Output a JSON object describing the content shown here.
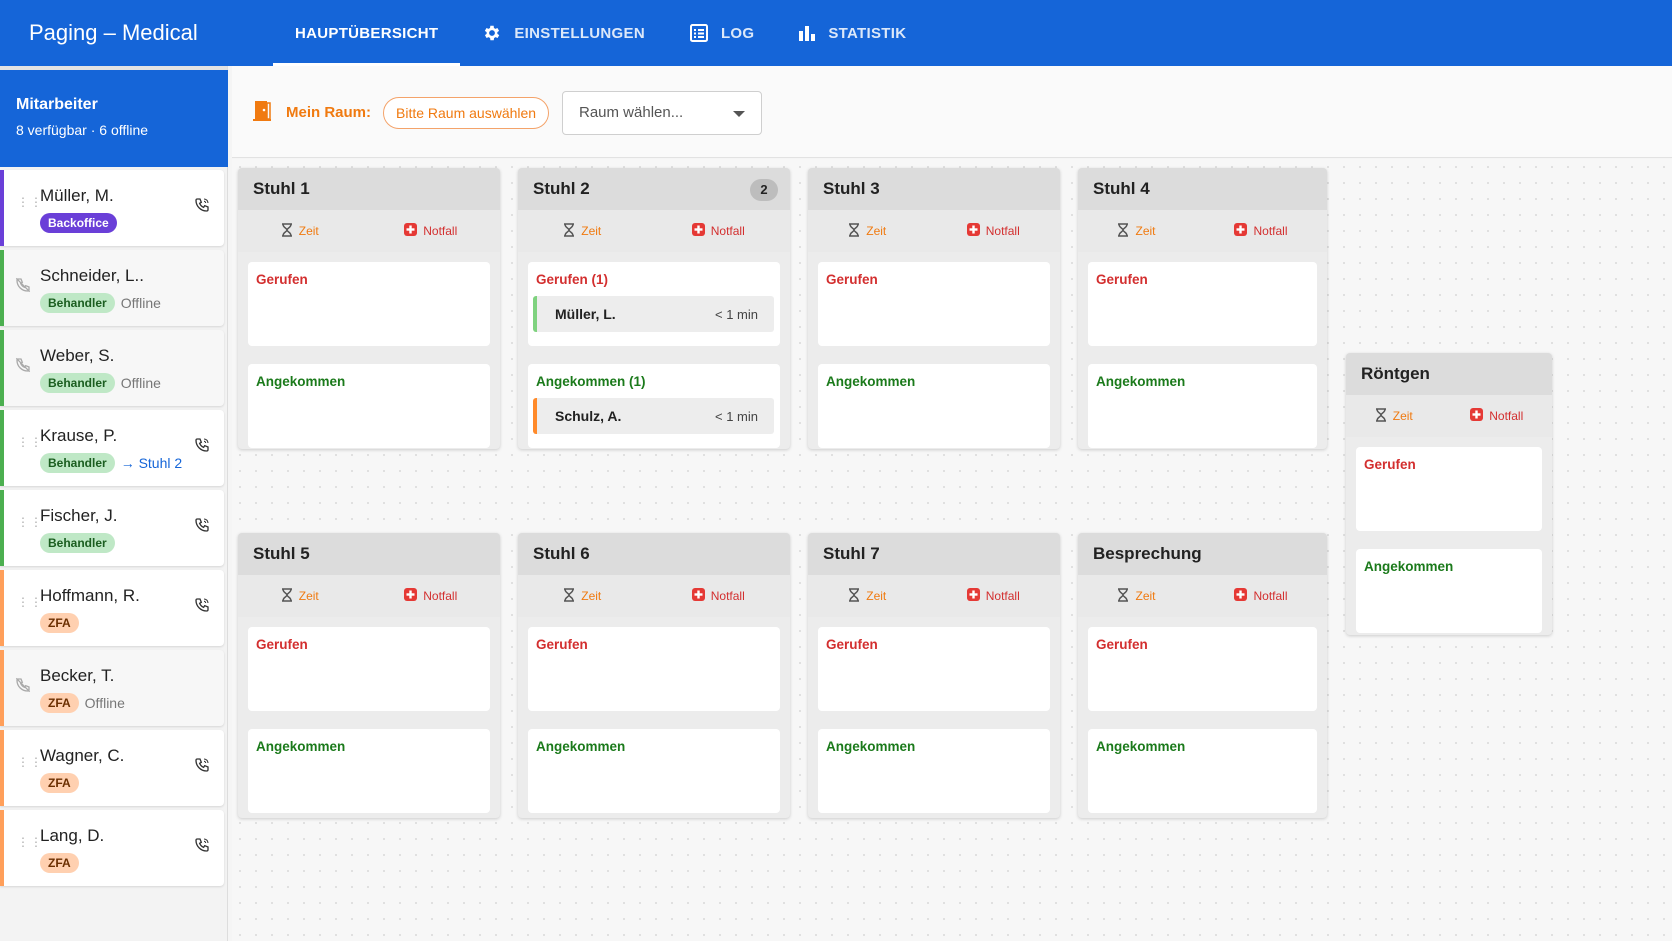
{
  "app": {
    "title": "Paging – Medical"
  },
  "nav": {
    "tabs": [
      {
        "label": "HAUPTÜBERSICHT",
        "icon": "none",
        "active": true
      },
      {
        "label": "EINSTELLUNGEN",
        "icon": "gear-icon"
      },
      {
        "label": "LOG",
        "icon": "list-icon"
      },
      {
        "label": "STATISTIK",
        "icon": "bar-chart-icon"
      }
    ]
  },
  "sidebar": {
    "title": "Mitarbeiter",
    "summary": "8 verfügbar · 6 offline",
    "staff": [
      {
        "name": "Müller, M.",
        "role": "Backoffice",
        "status": ""
      },
      {
        "name": "Schneider, L..",
        "role": "Behandler",
        "status": "Offline"
      },
      {
        "name": "Weber, S.",
        "role": "Behandler",
        "status": "Offline"
      },
      {
        "name": "Krause, P.",
        "role": "Behandler",
        "status": "→ Stuhl 2"
      },
      {
        "name": "Fischer, J.",
        "role": "Behandler",
        "status": ""
      },
      {
        "name": "Hoffmann, R.",
        "role": "ZFA",
        "status": ""
      },
      {
        "name": "Becker, T.",
        "role": "ZFA",
        "status": "Offline"
      },
      {
        "name": "Wagner, C.",
        "role": "ZFA",
        "status": ""
      },
      {
        "name": "Lang, D.",
        "role": "ZFA",
        "status": ""
      }
    ]
  },
  "roombar": {
    "label": "Mein Raum:",
    "chip": "Bitte Raum auswählen",
    "select_placeholder": "Raum wählen..."
  },
  "actions": {
    "zeit": "Zeit",
    "notfall": "Notfall"
  },
  "rooms": [
    {
      "name": "Stuhl 1",
      "count": "",
      "called": "Gerufen",
      "arrived": "Angekommen"
    },
    {
      "name": "Stuhl 2",
      "count": "2",
      "called": "Gerufen (1)",
      "arrived": "Angekommen (1)",
      "called_entry": {
        "name": "Müller, L.",
        "time": "< 1 min"
      },
      "arrived_entry": {
        "name": "Schulz, A.",
        "time": "< 1 min"
      }
    },
    {
      "name": "Stuhl 3",
      "count": "",
      "called": "Gerufen",
      "arrived": "Angekommen"
    },
    {
      "name": "Stuhl 4",
      "count": "",
      "called": "Gerufen",
      "arrived": "Angekommen"
    },
    {
      "name": "Röntgen",
      "count": "",
      "called": "Gerufen",
      "arrived": "Angekommen"
    },
    {
      "name": "Stuhl 5",
      "count": "",
      "called": "Gerufen",
      "arrived": "Angekommen"
    },
    {
      "name": "Stuhl 6",
      "count": "",
      "called": "Gerufen",
      "arrived": "Angekommen"
    },
    {
      "name": "Stuhl 7",
      "count": "",
      "called": "Gerufen",
      "arrived": "Angekommen"
    },
    {
      "name": "Besprechung",
      "count": "",
      "called": "Gerufen",
      "arrived": "Angekommen"
    }
  ],
  "colors": {
    "primary": "#1565d8",
    "accent_orange": "#f07a10",
    "called_red": "#d32f2f",
    "arrived_green": "#1b7a1b",
    "role_behandler": "#4caf50",
    "role_backoffice": "#6a3fd8",
    "role_zfa": "#ff9f5a"
  }
}
